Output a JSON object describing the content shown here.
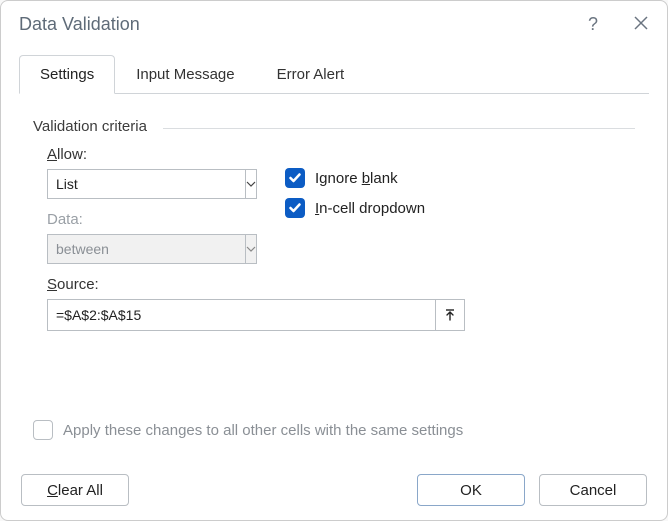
{
  "title": "Data Validation",
  "tabs": {
    "settings": "Settings",
    "inputMessage": "Input Message",
    "errorAlert": "Error Alert"
  },
  "criteria": {
    "legend": "Validation criteria",
    "allow_label_pre": "A",
    "allow_label_post": "llow:",
    "allow_value": "List",
    "data_label": "Data:",
    "data_value": "between",
    "ignoreBlank_pre": "Ignore ",
    "ignoreBlank_u": "b",
    "ignoreBlank_post": "lank",
    "incell_pre": "I",
    "incell_post": "n-cell dropdown",
    "source_label_u": "S",
    "source_label_post": "ource:",
    "source_value": "=$A$2:$A$15"
  },
  "apply": {
    "pre": "Apply these changes to all other cells with the same settings"
  },
  "buttons": {
    "clear_u": "C",
    "clear_post": "lear All",
    "ok": "OK",
    "cancel": "Cancel"
  }
}
